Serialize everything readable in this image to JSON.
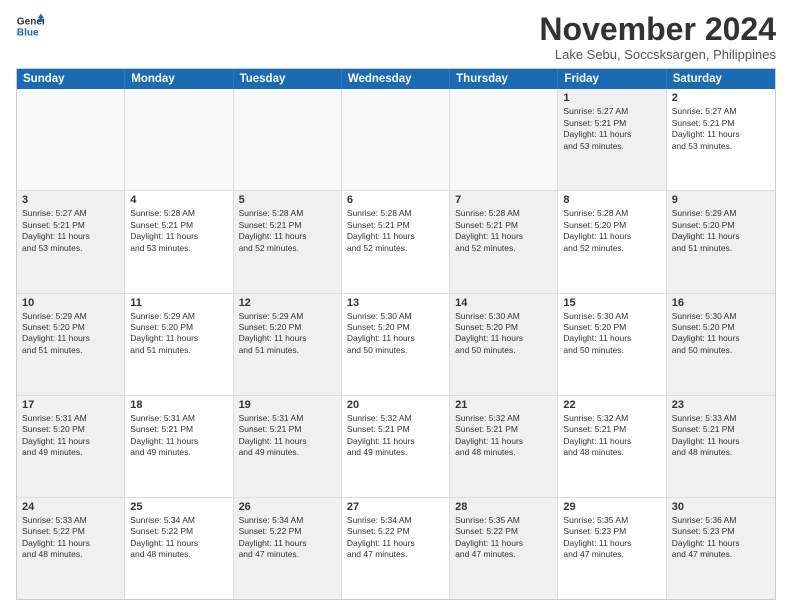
{
  "logo": {
    "line1": "General",
    "line2": "Blue"
  },
  "header": {
    "month": "November 2024",
    "location": "Lake Sebu, Soccsksargen, Philippines"
  },
  "days": [
    "Sunday",
    "Monday",
    "Tuesday",
    "Wednesday",
    "Thursday",
    "Friday",
    "Saturday"
  ],
  "weeks": [
    [
      {
        "day": "",
        "text": "",
        "empty": true
      },
      {
        "day": "",
        "text": "",
        "empty": true
      },
      {
        "day": "",
        "text": "",
        "empty": true
      },
      {
        "day": "",
        "text": "",
        "empty": true
      },
      {
        "day": "",
        "text": "",
        "empty": true
      },
      {
        "day": "1",
        "text": "Sunrise: 5:27 AM\nSunset: 5:21 PM\nDaylight: 11 hours\nand 53 minutes.",
        "empty": false,
        "shaded": true
      },
      {
        "day": "2",
        "text": "Sunrise: 5:27 AM\nSunset: 5:21 PM\nDaylight: 11 hours\nand 53 minutes.",
        "empty": false,
        "shaded": false
      }
    ],
    [
      {
        "day": "3",
        "text": "Sunrise: 5:27 AM\nSunset: 5:21 PM\nDaylight: 11 hours\nand 53 minutes.",
        "empty": false,
        "shaded": true
      },
      {
        "day": "4",
        "text": "Sunrise: 5:28 AM\nSunset: 5:21 PM\nDaylight: 11 hours\nand 53 minutes.",
        "empty": false,
        "shaded": false
      },
      {
        "day": "5",
        "text": "Sunrise: 5:28 AM\nSunset: 5:21 PM\nDaylight: 11 hours\nand 52 minutes.",
        "empty": false,
        "shaded": true
      },
      {
        "day": "6",
        "text": "Sunrise: 5:28 AM\nSunset: 5:21 PM\nDaylight: 11 hours\nand 52 minutes.",
        "empty": false,
        "shaded": false
      },
      {
        "day": "7",
        "text": "Sunrise: 5:28 AM\nSunset: 5:21 PM\nDaylight: 11 hours\nand 52 minutes.",
        "empty": false,
        "shaded": true
      },
      {
        "day": "8",
        "text": "Sunrise: 5:28 AM\nSunset: 5:20 PM\nDaylight: 11 hours\nand 52 minutes.",
        "empty": false,
        "shaded": false
      },
      {
        "day": "9",
        "text": "Sunrise: 5:29 AM\nSunset: 5:20 PM\nDaylight: 11 hours\nand 51 minutes.",
        "empty": false,
        "shaded": true
      }
    ],
    [
      {
        "day": "10",
        "text": "Sunrise: 5:29 AM\nSunset: 5:20 PM\nDaylight: 11 hours\nand 51 minutes.",
        "empty": false,
        "shaded": true
      },
      {
        "day": "11",
        "text": "Sunrise: 5:29 AM\nSunset: 5:20 PM\nDaylight: 11 hours\nand 51 minutes.",
        "empty": false,
        "shaded": false
      },
      {
        "day": "12",
        "text": "Sunrise: 5:29 AM\nSunset: 5:20 PM\nDaylight: 11 hours\nand 51 minutes.",
        "empty": false,
        "shaded": true
      },
      {
        "day": "13",
        "text": "Sunrise: 5:30 AM\nSunset: 5:20 PM\nDaylight: 11 hours\nand 50 minutes.",
        "empty": false,
        "shaded": false
      },
      {
        "day": "14",
        "text": "Sunrise: 5:30 AM\nSunset: 5:20 PM\nDaylight: 11 hours\nand 50 minutes.",
        "empty": false,
        "shaded": true
      },
      {
        "day": "15",
        "text": "Sunrise: 5:30 AM\nSunset: 5:20 PM\nDaylight: 11 hours\nand 50 minutes.",
        "empty": false,
        "shaded": false
      },
      {
        "day": "16",
        "text": "Sunrise: 5:30 AM\nSunset: 5:20 PM\nDaylight: 11 hours\nand 50 minutes.",
        "empty": false,
        "shaded": true
      }
    ],
    [
      {
        "day": "17",
        "text": "Sunrise: 5:31 AM\nSunset: 5:20 PM\nDaylight: 11 hours\nand 49 minutes.",
        "empty": false,
        "shaded": true
      },
      {
        "day": "18",
        "text": "Sunrise: 5:31 AM\nSunset: 5:21 PM\nDaylight: 11 hours\nand 49 minutes.",
        "empty": false,
        "shaded": false
      },
      {
        "day": "19",
        "text": "Sunrise: 5:31 AM\nSunset: 5:21 PM\nDaylight: 11 hours\nand 49 minutes.",
        "empty": false,
        "shaded": true
      },
      {
        "day": "20",
        "text": "Sunrise: 5:32 AM\nSunset: 5:21 PM\nDaylight: 11 hours\nand 49 minutes.",
        "empty": false,
        "shaded": false
      },
      {
        "day": "21",
        "text": "Sunrise: 5:32 AM\nSunset: 5:21 PM\nDaylight: 11 hours\nand 48 minutes.",
        "empty": false,
        "shaded": true
      },
      {
        "day": "22",
        "text": "Sunrise: 5:32 AM\nSunset: 5:21 PM\nDaylight: 11 hours\nand 48 minutes.",
        "empty": false,
        "shaded": false
      },
      {
        "day": "23",
        "text": "Sunrise: 5:33 AM\nSunset: 5:21 PM\nDaylight: 11 hours\nand 48 minutes.",
        "empty": false,
        "shaded": true
      }
    ],
    [
      {
        "day": "24",
        "text": "Sunrise: 5:33 AM\nSunset: 5:22 PM\nDaylight: 11 hours\nand 48 minutes.",
        "empty": false,
        "shaded": true
      },
      {
        "day": "25",
        "text": "Sunrise: 5:34 AM\nSunset: 5:22 PM\nDaylight: 11 hours\nand 48 minutes.",
        "empty": false,
        "shaded": false
      },
      {
        "day": "26",
        "text": "Sunrise: 5:34 AM\nSunset: 5:22 PM\nDaylight: 11 hours\nand 47 minutes.",
        "empty": false,
        "shaded": true
      },
      {
        "day": "27",
        "text": "Sunrise: 5:34 AM\nSunset: 5:22 PM\nDaylight: 11 hours\nand 47 minutes.",
        "empty": false,
        "shaded": false
      },
      {
        "day": "28",
        "text": "Sunrise: 5:35 AM\nSunset: 5:22 PM\nDaylight: 11 hours\nand 47 minutes.",
        "empty": false,
        "shaded": true
      },
      {
        "day": "29",
        "text": "Sunrise: 5:35 AM\nSunset: 5:23 PM\nDaylight: 11 hours\nand 47 minutes.",
        "empty": false,
        "shaded": false
      },
      {
        "day": "30",
        "text": "Sunrise: 5:36 AM\nSunset: 5:23 PM\nDaylight: 11 hours\nand 47 minutes.",
        "empty": false,
        "shaded": true
      }
    ]
  ]
}
